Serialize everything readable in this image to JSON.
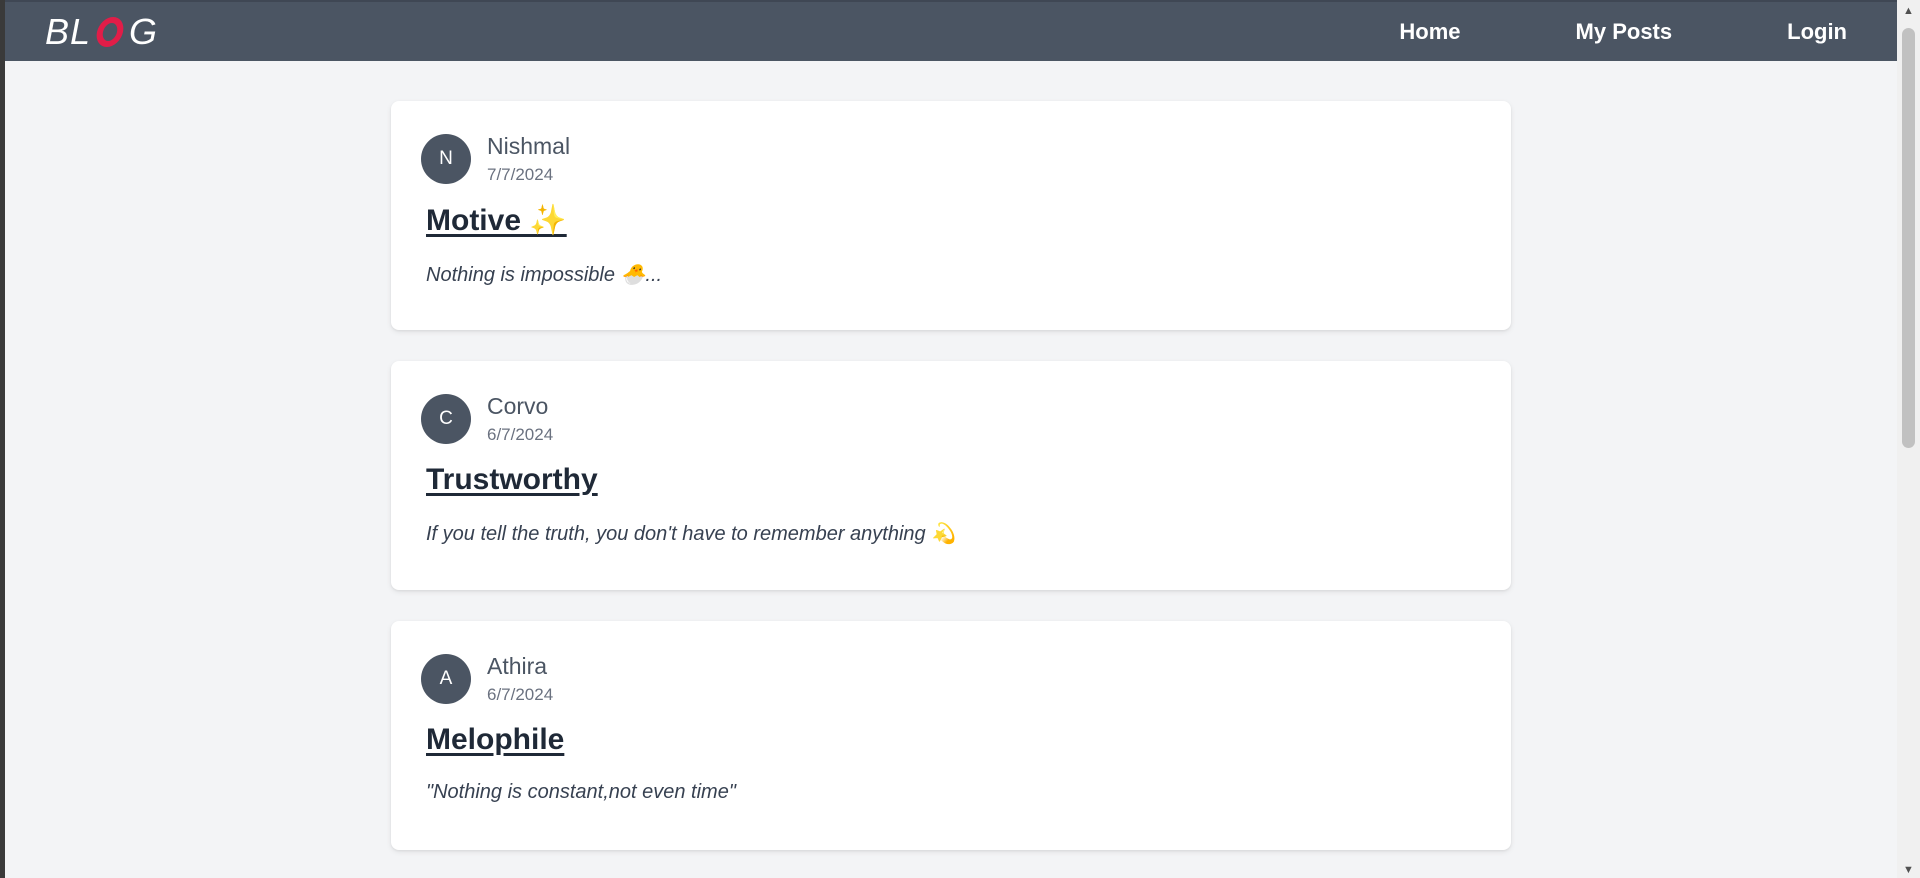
{
  "nav": {
    "logo_left": "BL",
    "logo_right": "G",
    "links": [
      "Home",
      "My Posts",
      "Login"
    ]
  },
  "posts": [
    {
      "initial": "N",
      "author": "Nishmal",
      "date": "7/7/2024",
      "title": "Motive ✨",
      "excerpt": "Nothing is impossible 🐣..."
    },
    {
      "initial": "C",
      "author": "Corvo",
      "date": "6/7/2024",
      "title": "Trustworthy",
      "excerpt": "If you tell the truth, you don't have to remember anything 💫"
    },
    {
      "initial": "A",
      "author": "Athira",
      "date": "6/7/2024",
      "title": "Melophile",
      "excerpt": "\"Nothing is constant,not even time\""
    }
  ],
  "scrollbar": {
    "up_icon": "▲",
    "down_icon": "▼"
  },
  "colors": {
    "navbar": "#4b5563",
    "logo_accent": "#e11d48",
    "background": "#f3f4f6",
    "card": "#ffffff",
    "avatar": "#4b5563",
    "title": "#1f2937"
  }
}
